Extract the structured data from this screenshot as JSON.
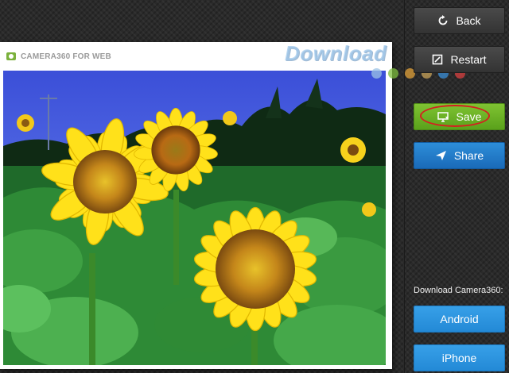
{
  "card": {
    "title": "CAMERA360 FOR WEB"
  },
  "watermark": {
    "text": "Download",
    "dot_colors": [
      "#9cc3e6",
      "#7fbf3f",
      "#e2a13a",
      "#c8a35a",
      "#3b8fd8",
      "#d84040"
    ]
  },
  "sidebar": {
    "back_label": "Back",
    "restart_label": "Restart",
    "save_label": "Save",
    "share_label": "Share",
    "download_heading": "Download Camera360:",
    "android_label": "Android",
    "iphone_label": "iPhone"
  },
  "colors": {
    "save_green": "#6cb42a",
    "share_blue": "#2480cc",
    "store_blue": "#2d95e0",
    "highlight_red": "#d42020"
  },
  "icons": {
    "back": "refresh-icon",
    "restart": "crop-icon",
    "save": "save-monitor-icon",
    "share": "send-icon",
    "brand": "camera-icon"
  }
}
